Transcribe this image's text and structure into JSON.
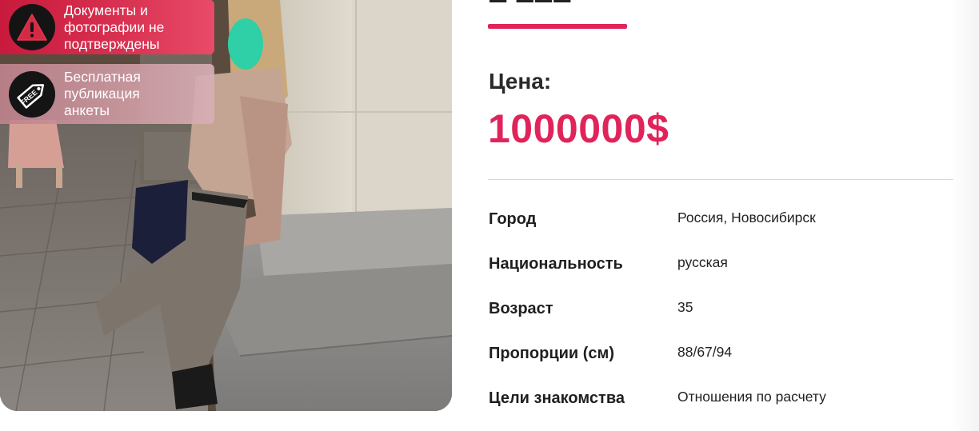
{
  "badges": {
    "warning": {
      "text": "Документы и\nфотографии не\nподтверждены",
      "icon": "warning-icon"
    },
    "free": {
      "text": "Бесплатная\nпубликация\nанкеты",
      "icon": "free-tag-icon",
      "tag_text": "FREE"
    }
  },
  "profile": {
    "price_label": "Цена:",
    "price_value": "1000000$",
    "details": [
      {
        "label": "Город",
        "value": "Россия, Новосибирск"
      },
      {
        "label": "Национальность",
        "value": "русская"
      },
      {
        "label": "Возраст",
        "value": "35"
      },
      {
        "label": "Пропорции (см)",
        "value": "88/67/94"
      },
      {
        "label": "Цели знакомства",
        "value": "Отношения по расчету"
      }
    ]
  },
  "colors": {
    "accent": "#e0245a",
    "warning_badge": "#d32a4b"
  }
}
